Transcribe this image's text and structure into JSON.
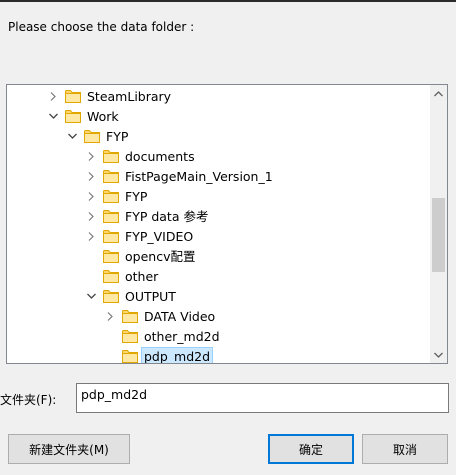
{
  "dialog": {
    "prompt": "Please choose the data folder :"
  },
  "tree": {
    "items": [
      {
        "label": "SteamLibrary",
        "expander": "collapsed",
        "depth": 1,
        "selected": false
      },
      {
        "label": "Work",
        "expander": "expanded",
        "depth": 1,
        "selected": false
      },
      {
        "label": "FYP",
        "expander": "expanded",
        "depth": 2,
        "selected": false
      },
      {
        "label": "documents",
        "expander": "collapsed",
        "depth": 3,
        "selected": false
      },
      {
        "label": "FistPageMain_Version_1",
        "expander": "collapsed",
        "depth": 3,
        "selected": false
      },
      {
        "label": "FYP",
        "expander": "collapsed",
        "depth": 3,
        "selected": false
      },
      {
        "label": "FYP data 参考",
        "expander": "collapsed",
        "depth": 3,
        "selected": false
      },
      {
        "label": "FYP_VIDEO",
        "expander": "collapsed",
        "depth": 3,
        "selected": false
      },
      {
        "label": "opencv配置",
        "expander": "none",
        "depth": 3,
        "selected": false
      },
      {
        "label": "other",
        "expander": "none",
        "depth": 3,
        "selected": false
      },
      {
        "label": "OUTPUT",
        "expander": "expanded",
        "depth": 3,
        "selected": false
      },
      {
        "label": "DATA Video",
        "expander": "collapsed",
        "depth": 4,
        "selected": false
      },
      {
        "label": "other_md2d",
        "expander": "none",
        "depth": 4,
        "selected": false
      },
      {
        "label": "pdp_md2d",
        "expander": "none",
        "depth": 4,
        "selected": true
      }
    ]
  },
  "folder_field": {
    "label": "文件夹(F):",
    "value": "pdp_md2d"
  },
  "buttons": {
    "new_folder": "新建文件夹(M)",
    "ok": "确定",
    "cancel": "取消"
  },
  "colors": {
    "folder": "#ffd66b",
    "selection": "#cce8ff",
    "accent": "#0078d7"
  }
}
